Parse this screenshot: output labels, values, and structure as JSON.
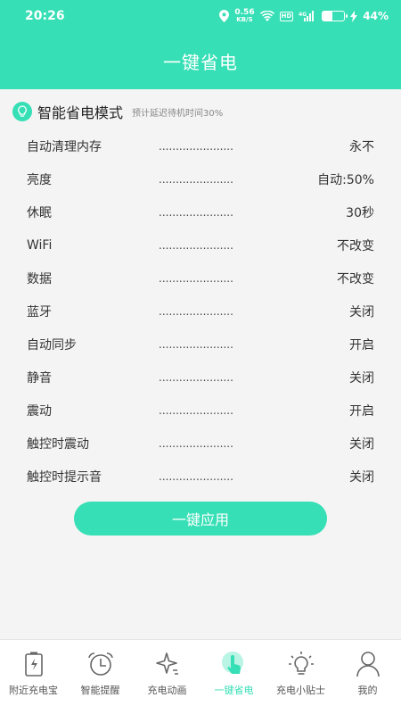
{
  "status_bar": {
    "time": "20:26",
    "net_speed": "0.56",
    "net_unit": "KB/S",
    "hd": "HD",
    "signal": "4G",
    "battery_level": 0.44,
    "battery_text": "44%"
  },
  "header": {
    "title": "一键省电"
  },
  "mode": {
    "icon": "lightbulb-icon",
    "title": "智能省电模式",
    "subtitle": "预计延迟待机时间30%"
  },
  "dots": "......................",
  "settings": [
    {
      "label": "自动清理内存",
      "value": "永不"
    },
    {
      "label": "亮度",
      "value": "自动:50%"
    },
    {
      "label": "休眠",
      "value": "30秒"
    },
    {
      "label": "WiFi",
      "value": "不改变"
    },
    {
      "label": "数据",
      "value": "不改变"
    },
    {
      "label": "蓝牙",
      "value": "关闭"
    },
    {
      "label": "自动同步",
      "value": "开启"
    },
    {
      "label": "静音",
      "value": "关闭"
    },
    {
      "label": "震动",
      "value": "开启"
    },
    {
      "label": "触控时震动",
      "value": "关闭"
    },
    {
      "label": "触控时提示音",
      "value": "关闭"
    }
  ],
  "apply_button": "一键应用",
  "tabs": [
    {
      "label": "附近充电宝",
      "icon": "power-bank-icon"
    },
    {
      "label": "智能提醒",
      "icon": "alarm-clock-icon"
    },
    {
      "label": "充电动画",
      "icon": "sparkle-icon"
    },
    {
      "label": "一键省电",
      "icon": "tap-hand-icon",
      "active": true
    },
    {
      "label": "充电小贴士",
      "icon": "lightbulb-icon"
    },
    {
      "label": "我的",
      "icon": "user-icon"
    }
  ],
  "colors": {
    "accent": "#36dfb5",
    "text": "#333333",
    "muted": "#888888"
  }
}
